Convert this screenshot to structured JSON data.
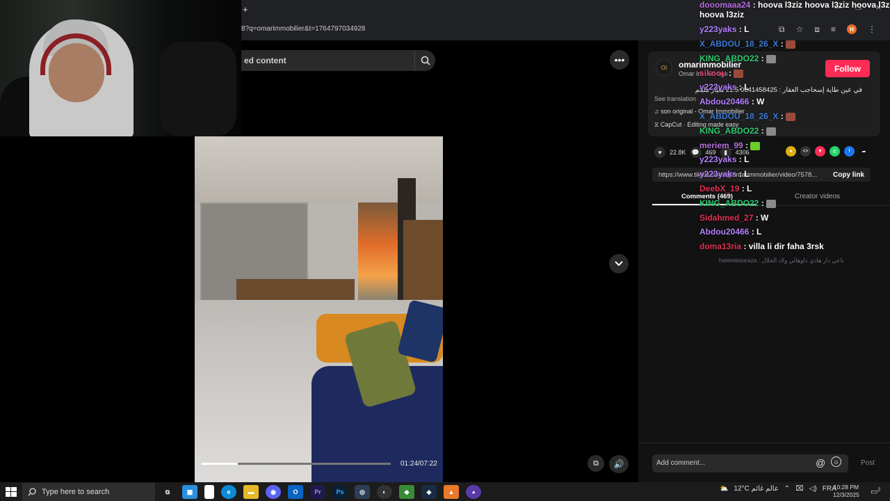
{
  "browser": {
    "new_tab": "+",
    "url": "8?q=omarimmobilier&t=1764797034928"
  },
  "search": {
    "placeholder": "ed content"
  },
  "video": {
    "current": "01:24/07:22",
    "progress": 0.19
  },
  "post": {
    "author": "omarimmobilier",
    "author_sub": "Omar Im           · 5d ago",
    "follow": "Follow",
    "description": "في عين طاية إسحاجب العقار : 0641458425 21.5 مليار مليتم",
    "see_translation": "See translation",
    "music": "son original - Omar Immobilier",
    "capcut": "CapCut · Editing made easy",
    "likes": "22.8K",
    "comments": "469",
    "saves": "4306",
    "link": "https://www.tiktok.com/@omarimmobilier/video/7578...",
    "copy_link": "Copy link",
    "tab_comments": "Comments (469)",
    "tab_creator": "Creator videos",
    "add_comment": "Add comment...",
    "post_btn": "Post"
  },
  "chat": [
    {
      "name": "dooomaaa24",
      "color": "#b86fe0",
      "msg": "hoova l3ziz hoova l3ziz hoova l3ziz"
    },
    {
      "name": "",
      "color": "#ffffff",
      "msg": "hoova l3ziz"
    },
    {
      "name": "y223yaks",
      "color": "#b47fff",
      "msg": "L"
    },
    {
      "name": "X_ABDOU_18_26_X",
      "color": "#3a7bd5",
      "msg": ""
    },
    {
      "name": "KING_ABDO22",
      "color": "#2ecc71",
      "msg": ""
    },
    {
      "name": "sikoou",
      "color": "#e04070",
      "msg": ""
    },
    {
      "name": "y223yaks",
      "color": "#b47fff",
      "msg": "L"
    },
    {
      "name": "Abdou20466",
      "color": "#b47fff",
      "msg": "W"
    },
    {
      "name": "X_ABDOU_18_26_X",
      "color": "#3a7bd5",
      "msg": ""
    },
    {
      "name": "KING_ABDO22",
      "color": "#2ecc71",
      "msg": ""
    },
    {
      "name": "meriem_99",
      "color": "#b86fe0",
      "msg": ""
    },
    {
      "name": "y223yaks",
      "color": "#b47fff",
      "msg": "L"
    },
    {
      "name": "y223yaks",
      "color": "#b47fff",
      "msg": "L"
    },
    {
      "name": "DeebX_19",
      "color": "#e03050",
      "msg": "L"
    },
    {
      "name": "KING_ABDO22",
      "color": "#2ecc71",
      "msg": ""
    },
    {
      "name": "Sidahmed_27",
      "color": "#e03050",
      "msg": "W"
    },
    {
      "name": "Abdou20466",
      "color": "#b47fff",
      "msg": "L"
    },
    {
      "name": "doma13ria",
      "color": "#e03050",
      "msg": "villa li dir faha 3rsk"
    }
  ],
  "chat_faded": "hatembouraza : تاعي دار هادي داوهالي ولاد الحلال",
  "taskbar": {
    "search": "Type here to search",
    "weather": "12°C  عالم غائم",
    "lang": "FRA",
    "time": "10:28 PM",
    "date": "12/3/2025",
    "notif": "2"
  }
}
